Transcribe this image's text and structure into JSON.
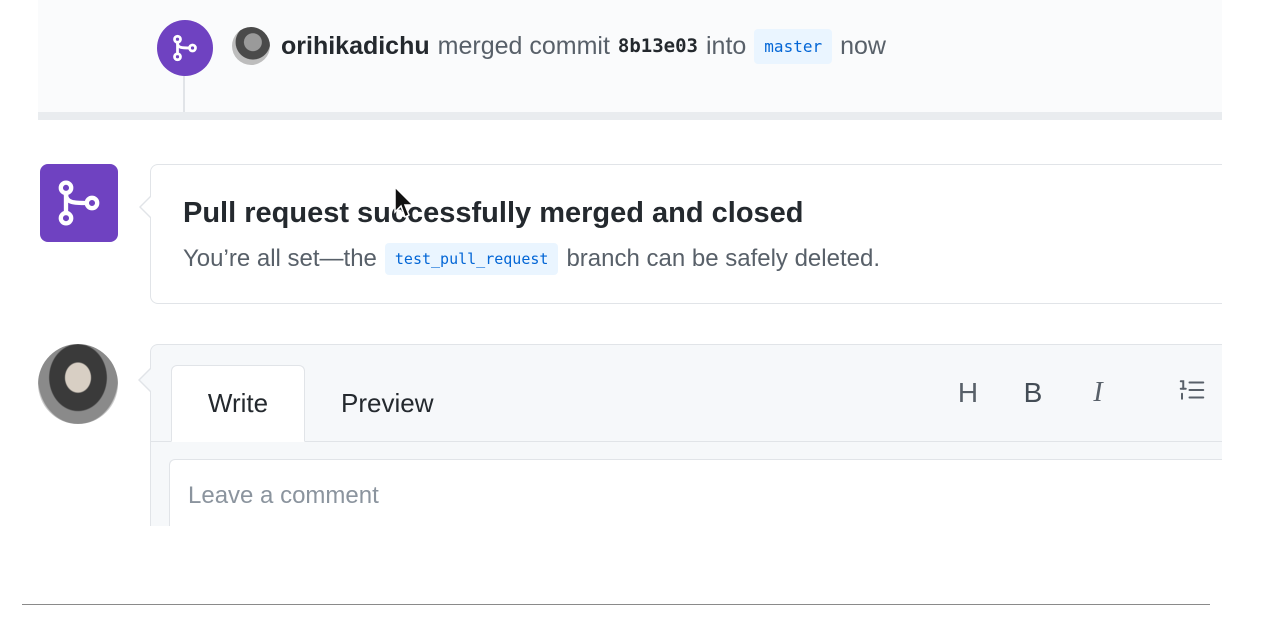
{
  "merge_event": {
    "author": "orihikadichu",
    "action": "merged commit",
    "commit_sha": "8b13e03",
    "into_text": "into",
    "base_branch": "master",
    "time": "now",
    "badge_icon": "git-merge-icon"
  },
  "merged_box": {
    "icon": "git-merge-icon",
    "title": "Pull request successfully merged and closed",
    "desc_prefix": "You’re all set—the",
    "branch": "test_pull_request",
    "desc_suffix": "branch can be safely deleted."
  },
  "composer": {
    "tabs": [
      "Write",
      "Preview"
    ],
    "active_tab": "Write",
    "toolbar": {
      "heading": "H",
      "bold": "B",
      "italic": "I",
      "list_icon": "ordered-list-icon"
    },
    "placeholder": "Leave a comment"
  },
  "colors": {
    "merged_purple": "#6f42c1",
    "link_blue": "#0366d6",
    "text_primary": "#24292e",
    "text_muted": "#586069"
  }
}
